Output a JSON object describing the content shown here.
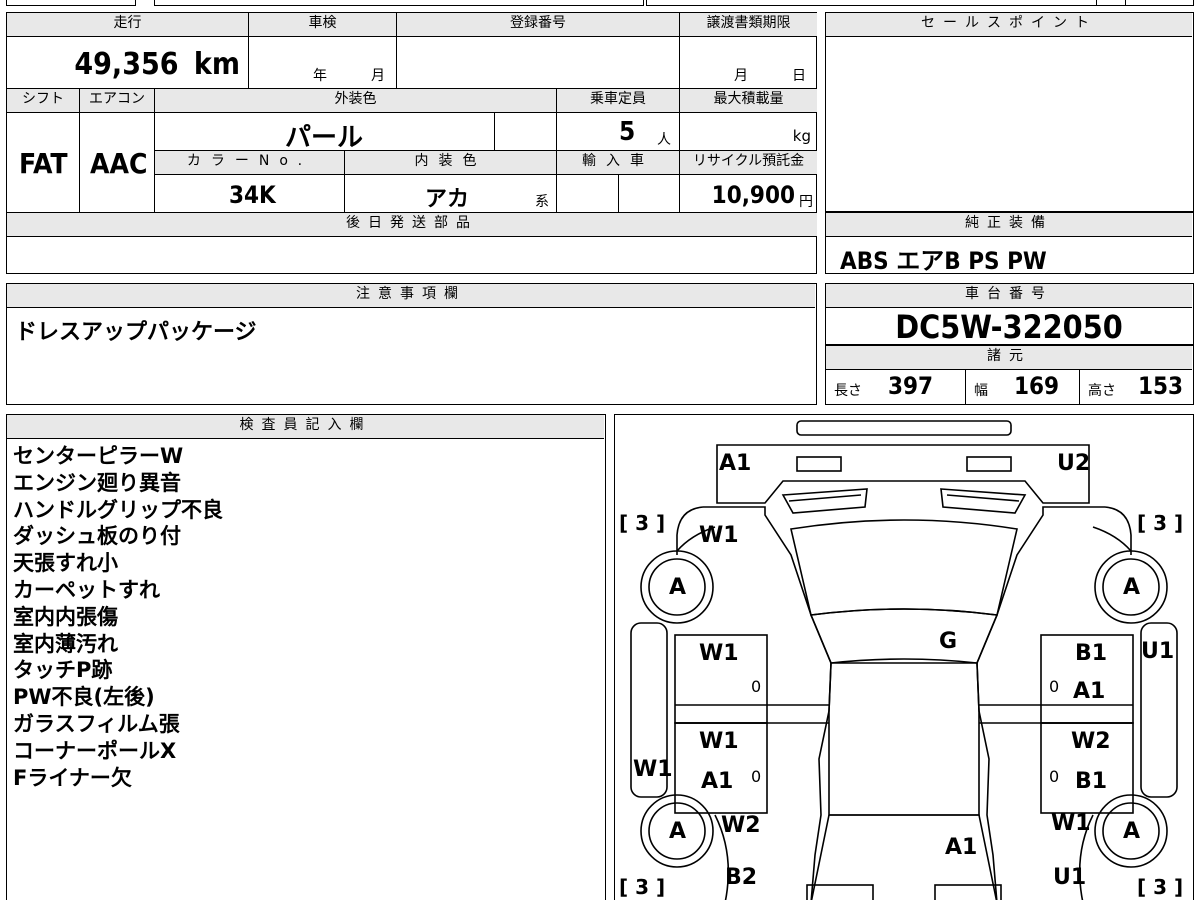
{
  "header": {
    "mileage_label": "走行",
    "mileage_value": "49,356",
    "mileage_unit": "km",
    "shaken_label": "車検",
    "shaken_year": "年",
    "shaken_month": "月",
    "reg_label": "登録番号",
    "transfer_label": "譲渡書類期限",
    "transfer_month": "月",
    "transfer_day": "日",
    "shift_label": "シフト",
    "shift_value": "FAT",
    "ac_label": "エアコン",
    "ac_value": "AAC",
    "ext_color_label": "外装色",
    "ext_color_value": "パール",
    "capacity_label": "乗車定員",
    "capacity_value": "5",
    "capacity_unit": "人",
    "maxload_label": "最大積載量",
    "maxload_unit": "kg",
    "colorno_label": "カラーNo.",
    "colorno_value": "34K",
    "int_color_label": "内装色",
    "int_color_value": "アカ",
    "int_color_suffix": "系",
    "import_label": "輸入車",
    "recycle_label": "リサイクル預託金",
    "recycle_value": "10,900",
    "recycle_unit": "円"
  },
  "sales_point": {
    "label": "セールスポイント"
  },
  "later_parts": {
    "label": "後日発送部品"
  },
  "equipment": {
    "label": "純正装備",
    "value": "ABS エアB PS PW"
  },
  "notes": {
    "label": "注意事項欄",
    "value": "ドレスアップパッケージ"
  },
  "chassis": {
    "label": "車台番号",
    "value": "DC5W-322050"
  },
  "specs": {
    "label": "諸元",
    "length_label": "長さ",
    "length_value": "397",
    "width_label": "幅",
    "width_value": "169",
    "height_label": "高さ",
    "height_value": "153"
  },
  "inspector": {
    "label": "検査員記入欄",
    "lines": [
      "センターピラーW",
      "エンジン廻り異音",
      "ハンドルグリップ不良",
      "ダッシュ板のり付",
      "天張すれ小",
      "カーペットすれ",
      "室内内張傷",
      "室内薄汚れ",
      "タッチP跡",
      "PW不良(左後)",
      "ガラスフィルム張",
      "コーナーポールX",
      "Fライナー欠"
    ]
  },
  "diagram": {
    "marks": {
      "a1_front_left": "A1",
      "u2_front_right": "U2",
      "tl_bracket": "[ 3 ]",
      "tr_bracket": "[ 3 ]",
      "bl_bracket": "[ 3 ]",
      "br_bracket": "[ 3 ]",
      "w1_front_fender": "W1",
      "wheel_a": "A",
      "w1_left_front_door": "W1",
      "g_roof": "G",
      "b1_right_front_door": "B1",
      "a1_right_front_door": "A1",
      "u1_right_side": "U1",
      "w1_left_rear_door": "W1",
      "a1_left_rear_door": "A1",
      "w1_left_side": "W1",
      "w2_right_rear_door": "W2",
      "b1_right_rear_door": "B1",
      "w2_rear_left": "W2",
      "b2_rear_left": "B2",
      "a1_rear_center": "A1",
      "w1_rear_right": "W1",
      "u1_rear_right": "U1",
      "zero": "0"
    }
  }
}
